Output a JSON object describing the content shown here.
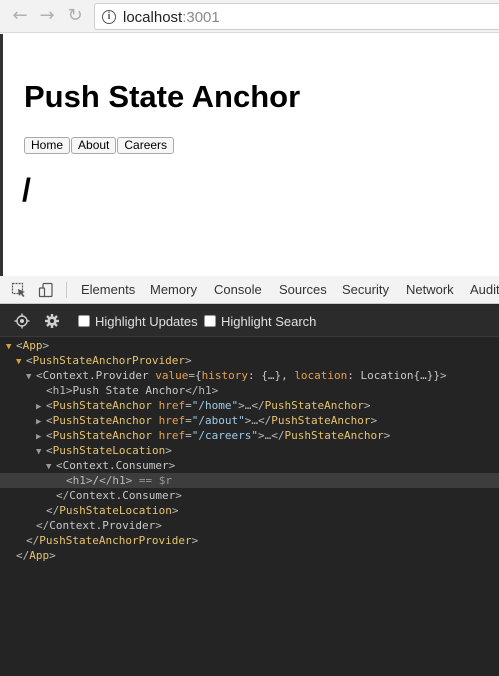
{
  "browser": {
    "back_icon": "arrow-left-icon",
    "forward_icon": "arrow-right-icon",
    "reload_icon": "reload-icon",
    "url_host": "localhost",
    "url_port": ":3001"
  },
  "page": {
    "title": "Push State Anchor",
    "links": [
      "Home",
      "About",
      "Careers"
    ],
    "current_path": "/"
  },
  "devtools": {
    "tabs": [
      "Elements",
      "Memory",
      "Console",
      "Sources",
      "Security",
      "Network",
      "Audit"
    ],
    "react": {
      "highlight_updates": "Highlight Updates",
      "highlight_search": "Highlight Search"
    },
    "tree": {
      "app_open": "App",
      "provider_open": "PushStateAnchorProvider",
      "ctx_provider": "Context.Provider",
      "ctx_value_attr": "value",
      "ctx_value": "{history: {…}, location: Location{…}}",
      "h1_text": "Push State Anchor",
      "anchor_tag": "PushStateAnchor",
      "href_attr": "href",
      "anchor_home": "\"/home\"",
      "anchor_about": "\"/about\"",
      "anchor_careers": "\"/careers\"",
      "location_tag": "PushStateLocation",
      "ctx_consumer": "Context.Consumer",
      "h1_slash": "/",
      "selected_suffix": " == $r",
      "ellipsis": "…"
    }
  }
}
